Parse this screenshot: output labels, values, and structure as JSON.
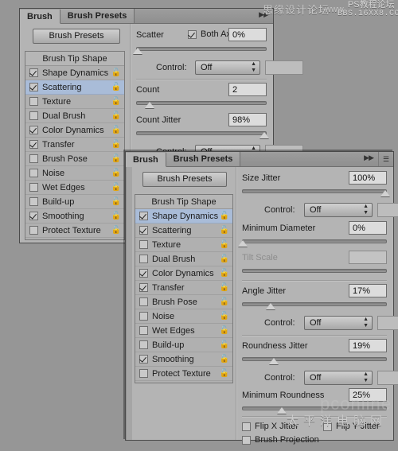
{
  "window": {
    "background_color": "#969696"
  },
  "watermarks": {
    "top_left_cn": "思缘设计论坛",
    "top_right_line1": "PS教程论坛",
    "top_right_line2": "BBS.16XX8.COM",
    "top_middle_www": "www",
    "bottom_cn": "太平洋电脑网",
    "bottom_brand": "pconline"
  },
  "panel1": {
    "tabs": [
      {
        "label": "Brush",
        "active": true
      },
      {
        "label": "Brush Presets",
        "active": false
      }
    ],
    "tab_arrows_icon": "double-chevron-right-icon",
    "presets_button": "Brush Presets",
    "list": {
      "header": "Brush Tip Shape",
      "items": [
        {
          "label": "Shape Dynamics",
          "checked": true,
          "selected": false
        },
        {
          "label": "Scattering",
          "checked": true,
          "selected": true
        },
        {
          "label": "Texture",
          "checked": false,
          "selected": false
        },
        {
          "label": "Dual Brush",
          "checked": false,
          "selected": false
        },
        {
          "label": "Color Dynamics",
          "checked": true,
          "selected": false
        },
        {
          "label": "Transfer",
          "checked": true,
          "selected": false
        },
        {
          "label": "Brush Pose",
          "checked": false,
          "selected": false
        },
        {
          "label": "Noise",
          "checked": false,
          "selected": false
        },
        {
          "label": "Wet Edges",
          "checked": false,
          "selected": false
        },
        {
          "label": "Build-up",
          "checked": false,
          "selected": false
        },
        {
          "label": "Smoothing",
          "checked": true,
          "selected": false
        },
        {
          "label": "Protect Texture",
          "checked": false,
          "selected": false
        }
      ],
      "lock_icon": "lock-icon"
    },
    "controls": {
      "scatter_label": "Scatter",
      "both_axes_label": "Both Axes",
      "both_axes_checked": true,
      "scatter_value": "0%",
      "scatter_slider_pct": 0,
      "control1_label": "Control:",
      "control1_value": "Off",
      "count_label": "Count",
      "count_value": "2",
      "count_slider_pct": 7,
      "count_jitter_label": "Count Jitter",
      "count_jitter_value": "98%",
      "count_jitter_slider_pct": 98,
      "control2_label": "Control:",
      "control2_value": "Off"
    }
  },
  "panel2": {
    "tabs": [
      {
        "label": "Brush",
        "active": true
      },
      {
        "label": "Brush Presets",
        "active": false
      }
    ],
    "tab_arrows_icon": "double-chevron-right-icon",
    "tab_menu_icon": "panel-menu-icon",
    "presets_button": "Brush Presets",
    "list": {
      "header": "Brush Tip Shape",
      "items": [
        {
          "label": "Shape Dynamics",
          "checked": true,
          "selected": true
        },
        {
          "label": "Scattering",
          "checked": true,
          "selected": false
        },
        {
          "label": "Texture",
          "checked": false,
          "selected": false
        },
        {
          "label": "Dual Brush",
          "checked": false,
          "selected": false
        },
        {
          "label": "Color Dynamics",
          "checked": true,
          "selected": false
        },
        {
          "label": "Transfer",
          "checked": true,
          "selected": false
        },
        {
          "label": "Brush Pose",
          "checked": false,
          "selected": false
        },
        {
          "label": "Noise",
          "checked": false,
          "selected": false
        },
        {
          "label": "Wet Edges",
          "checked": false,
          "selected": false
        },
        {
          "label": "Build-up",
          "checked": false,
          "selected": false
        },
        {
          "label": "Smoothing",
          "checked": true,
          "selected": false
        },
        {
          "label": "Protect Texture",
          "checked": false,
          "selected": false
        }
      ],
      "lock_icon": "lock-icon"
    },
    "controls": {
      "size_jitter_label": "Size Jitter",
      "size_jitter_value": "100%",
      "size_jitter_slider_pct": 100,
      "control1_label": "Control:",
      "control1_value": "Off",
      "min_diameter_label": "Minimum Diameter",
      "min_diameter_value": "0%",
      "min_diameter_slider_pct": 0,
      "tilt_scale_label": "Tilt Scale",
      "tilt_scale_value": "",
      "tilt_scale_slider_pct": 0,
      "angle_jitter_label": "Angle Jitter",
      "angle_jitter_value": "17%",
      "angle_jitter_slider_pct": 17,
      "control2_label": "Control:",
      "control2_value": "Off",
      "roundness_jitter_label": "Roundness Jitter",
      "roundness_jitter_value": "19%",
      "roundness_jitter_slider_pct": 19,
      "control3_label": "Control:",
      "control3_value": "Off",
      "min_roundness_label": "Minimum Roundness",
      "min_roundness_value": "25%",
      "min_roundness_slider_pct": 25,
      "flip_x_label": "Flip X Jitter",
      "flip_x_checked": false,
      "flip_y_label": "Flip Y Jitter",
      "flip_y_checked": false,
      "brush_projection_label": "Brush Projection",
      "brush_projection_checked": false
    }
  }
}
